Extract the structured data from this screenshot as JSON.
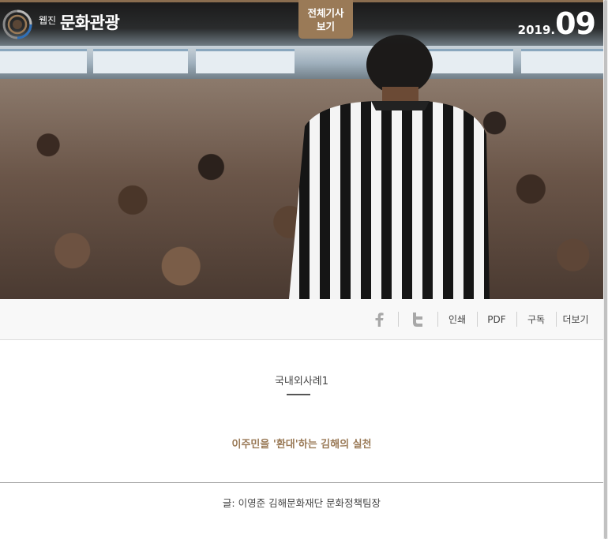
{
  "header": {
    "logo_small": "웹진",
    "logo_big": "문화관광",
    "all_articles_line1": "전체기사",
    "all_articles_line2": "보기",
    "issue_year": "2019.",
    "issue_month": "09"
  },
  "hero": {
    "image_icon": "crowd-photo"
  },
  "toolbar": {
    "facebook_icon": "facebook-icon",
    "twitter_icon": "twitter-icon",
    "print_label": "인쇄",
    "pdf_label": "PDF",
    "subscribe_label": "구독",
    "more_label": "더보기"
  },
  "article": {
    "category": "국내외사례1",
    "headline": "이주민을 '환대'하는 김해의 실천",
    "byline": "글: 이영준 김해문화재단 문화정책팀장"
  },
  "colors": {
    "accent": "#9a7a57",
    "toolbar_bg": "#f8f8f8",
    "text": "#444444"
  }
}
